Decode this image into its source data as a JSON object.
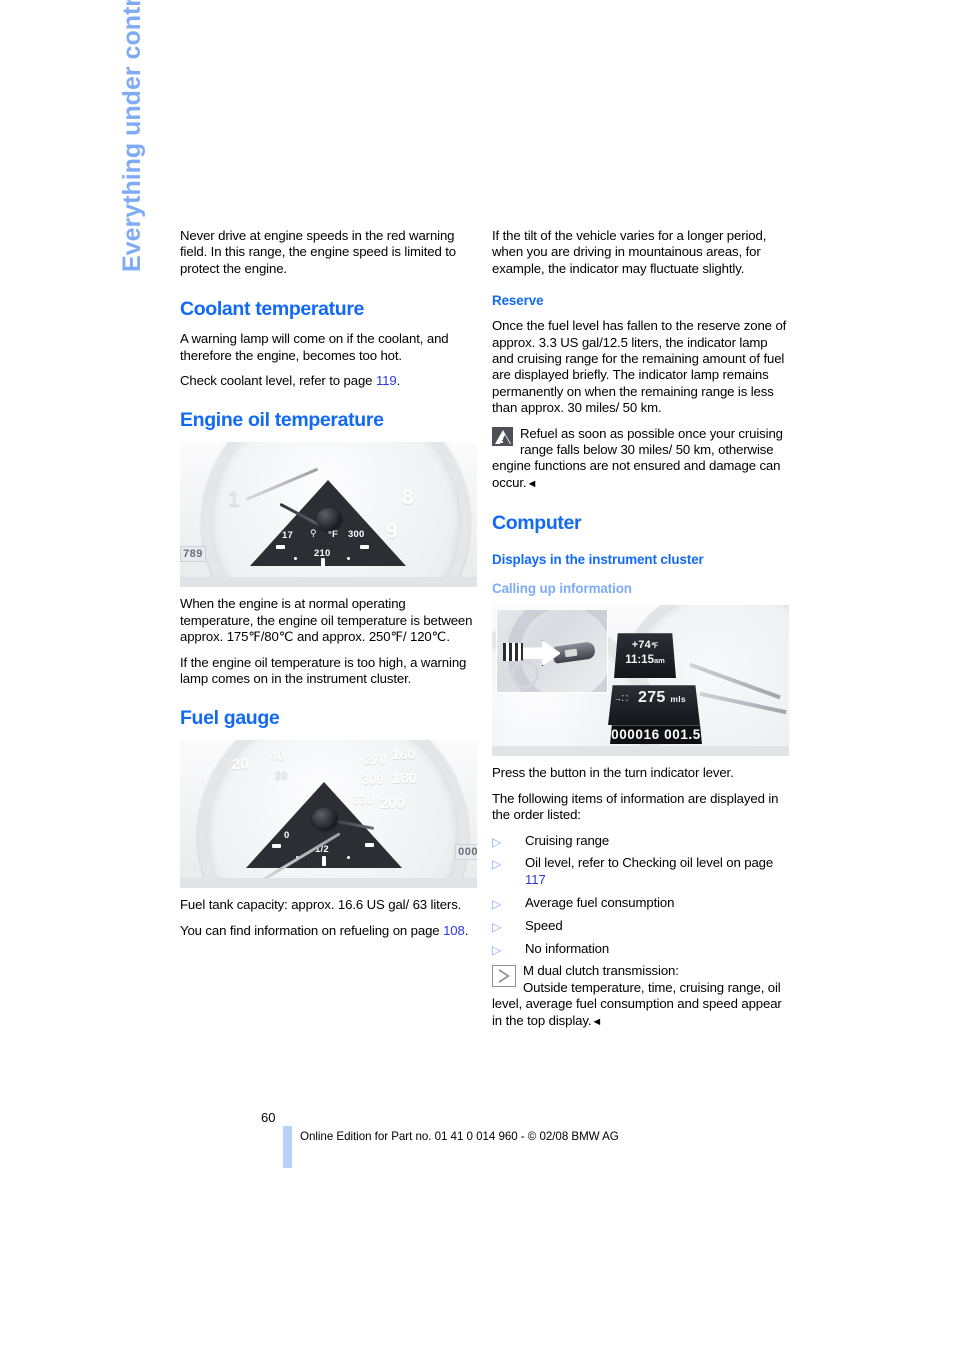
{
  "sidebar": {
    "tab_label": "Everything under control"
  },
  "left_column": {
    "intro_paragraph": "Never drive at engine speeds in the red warning field. In this range, the engine speed is limited to protect the engine.",
    "coolant": {
      "heading": "Coolant temperature",
      "paragraph_1": "A warning lamp will come on if the coolant, and therefore the engine, becomes too hot.",
      "paragraph_2_prefix": "Check coolant level, refer to page ",
      "paragraph_2_page": "119",
      "paragraph_2_suffix": "."
    },
    "engine_oil": {
      "heading": "Engine oil temperature",
      "figure": {
        "name": "engine-oil-temperature-gauge",
        "gauge_unit": "°F",
        "gauge_max": "300",
        "gauge_mid": "210",
        "gauge_low": "17",
        "tach_labels": [
          "1",
          "8",
          "9"
        ],
        "odometer_fragment": "789"
      },
      "paragraph_1": "When the engine is at normal operating temperature, the engine oil temperature is between approx. 175℉/80℃ and approx. 250℉/ 120℃.",
      "paragraph_2": "If the engine oil temperature is too high, a warning lamp comes on in the instrument cluster."
    },
    "fuel_gauge": {
      "heading": "Fuel gauge",
      "figure": {
        "name": "fuel-gauge",
        "scale_zero": "0",
        "scale_half": "1/2",
        "speed_labels": [
          "20",
          "40",
          "20",
          "270",
          "300",
          "330",
          "160",
          "180",
          "200"
        ],
        "odometer_fragment": "000"
      },
      "paragraph_1": "Fuel tank capacity: approx. 16.6 US gal/ 63 liters.",
      "paragraph_2_prefix": "You can find information on refueling on page ",
      "paragraph_2_page": "108",
      "paragraph_2_suffix": "."
    }
  },
  "right_column": {
    "tilt_paragraph": "If the tilt of the vehicle varies for a longer period, when you are driving in mountainous areas, for example, the indicator may fluctuate slightly.",
    "reserve": {
      "heading": "Reserve",
      "paragraph_1": "Once the fuel level has fallen to the reserve zone of approx. 3.3 US gal/12.5 liters, the indicator lamp and cruising range for the remaining amount of fuel are displayed briefly. The indicator lamp remains permanently on when the remaining range is less than approx. 30 miles/ 50 km.",
      "warning_note": "Refuel as soon as possible once your cruising range falls below 30 miles/ 50 km, otherwise engine functions are not ensured and damage can occur.",
      "warning_icon": "warning-triangle-icon",
      "end_mark": "◄"
    },
    "computer": {
      "heading": "Computer",
      "subheading": "Displays in the instrument cluster",
      "subsubheading": "Calling up information",
      "figure": {
        "name": "instrument-cluster-computer-display",
        "inset_name": "turn-indicator-lever-button",
        "outside_temp": "+74",
        "outside_temp_unit": "℉",
        "time": "11:15",
        "time_ampm": "am",
        "range_value": "275",
        "range_unit": "mls",
        "odometer": "000016",
        "trip": "001.5"
      },
      "paragraph_1": "Press the button in the turn indicator lever.",
      "paragraph_2": "The following items of information are displayed in the order listed:",
      "bullets": [
        {
          "text": "Cruising range"
        },
        {
          "text": "Oil level, refer to Checking oil level on page ",
          "page": "117"
        },
        {
          "text": "Average fuel consumption"
        },
        {
          "text": "Speed"
        },
        {
          "text": "No information"
        }
      ],
      "boxed_note": {
        "icon": "boxed-triangle-icon",
        "label": "M dual clutch transmission:",
        "text": "Outside temperature, time, cruising range, oil level, average fuel consumption and speed appear in the top display.",
        "end_mark": "◄"
      }
    }
  },
  "footer": {
    "page_number": "60",
    "edition_line": "Online Edition for Part no. 01 41 0 014 960 - © 02/08 BMW AG"
  },
  "colors": {
    "heading_blue": "#1169f5",
    "light_blue": "#7fabf5",
    "xref_blue": "#2a37e8",
    "footer_bar": "#b6d2f7"
  }
}
